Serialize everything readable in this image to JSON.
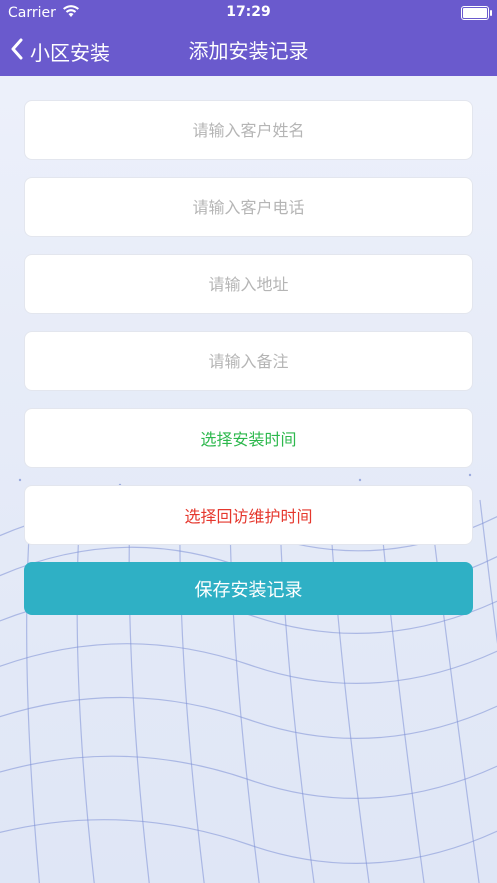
{
  "status_bar": {
    "carrier": "Carrier",
    "time": "17:29"
  },
  "nav": {
    "back_label": "小区安装",
    "title": "添加安装记录",
    "background_color": "#6a5acd"
  },
  "form": {
    "customer_name_placeholder": "请输入客户姓名",
    "customer_phone_placeholder": "请输入客户电话",
    "address_placeholder": "请输入地址",
    "remark_placeholder": "请输入备注",
    "install_time_label": "选择安装时间",
    "install_time_color": "#2db84d",
    "followup_time_label": "选择回访维护时间",
    "followup_time_color": "#e5372d",
    "save_label": "保存安装记录",
    "save_color": "#2fb0c5"
  },
  "icons": {
    "wifi": "wifi-icon",
    "battery": "battery-icon",
    "back": "chevron-left-icon"
  }
}
